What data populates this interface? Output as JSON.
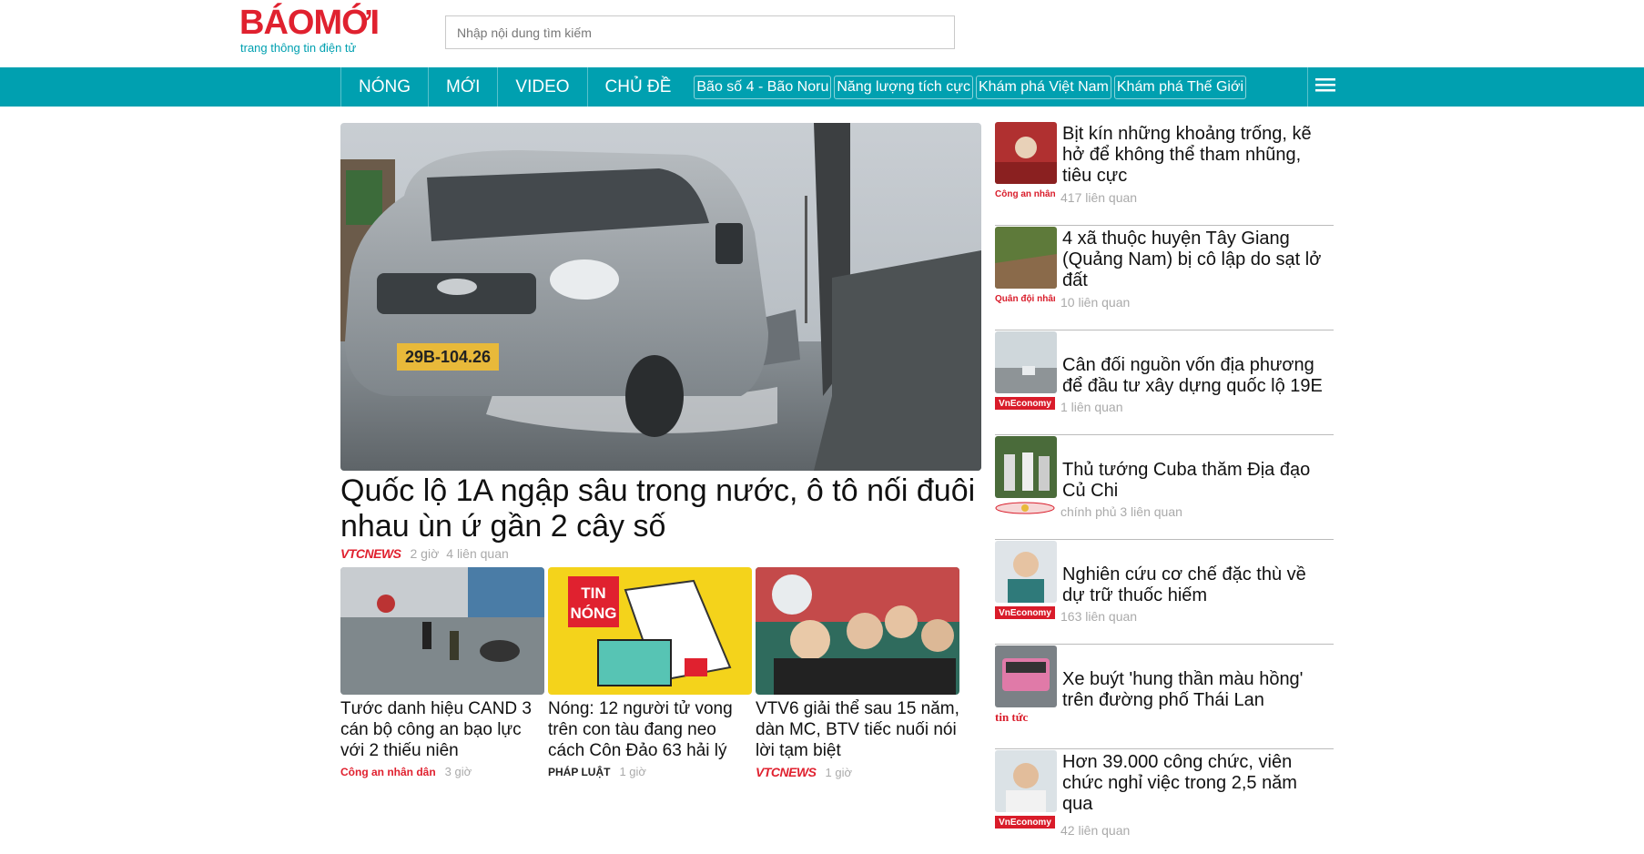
{
  "header": {
    "logo_text": "BÁOMỚI",
    "tagline": "trang thông tin điện tử",
    "search_placeholder": "Nhập nội dung tìm kiếm"
  },
  "nav": {
    "items": [
      "NÓNG",
      "MỚI",
      "VIDEO",
      "CHỦ ĐỀ"
    ],
    "topics": [
      "Bão số 4 - Bão Noru",
      "Năng lượng tích cực",
      "Khám phá Việt Nam",
      "Khám phá Thế Giới"
    ]
  },
  "hero": {
    "title": "Quốc lộ 1A ngập sâu trong nước, ô tô nối đuôi nhau ùn ứ gần 2 cây số",
    "source": "VTCNEWS",
    "time": "2 giờ",
    "related": "4 liên quan",
    "plate": "29B-104.26"
  },
  "cards": [
    {
      "title": "Tước danh hiệu CAND 3 cán bộ công an bạo lực với 2 thiếu niên",
      "source": "Công an nhân dân",
      "time": "3 giờ"
    },
    {
      "title": "Nóng: 12 người tử vong trên con tàu đang neo cách Côn Đảo 63 hải lý",
      "source": "PHÁP LUẬT",
      "time": "1 giờ",
      "thumb_badge": [
        "TIN",
        "NÓNG"
      ]
    },
    {
      "title": "VTV6 giải thể sau 15 năm, dàn MC, BTV tiếc nuối nói lời tạm biệt",
      "source": "VTCNEWS",
      "time": "1 giờ"
    }
  ],
  "sidebar": [
    {
      "title": "Bịt kín những khoảng trống, kẽ hở để không thể tham nhũng, tiêu cực",
      "source": "Công an nhân dân",
      "meta": "417 liên quan"
    },
    {
      "title": "4 xã thuộc huyện Tây Giang (Quảng Nam) bị cô lập do sạt lở đất",
      "source": "Quân đội nhân dân",
      "meta": "10 liên quan"
    },
    {
      "title": "Cân đối nguồn vốn địa phương để đầu tư xây dựng quốc lộ 19E",
      "source": "VnEconomy",
      "meta": "1 liên quan"
    },
    {
      "title": "Thủ tướng Cuba thăm Địa đạo Củ Chi",
      "source": "chính phủ",
      "meta": "chính phủ 3 liên quan"
    },
    {
      "title": "Nghiên cứu cơ chế đặc thù về dự trữ thuốc hiếm",
      "source": "VnEconomy",
      "meta": "163 liên quan"
    },
    {
      "title": "Xe buýt 'hung thần màu hồng' trên đường phố Thái Lan",
      "source": "tin tức",
      "meta": ""
    },
    {
      "title": "Hơn 39.000 công chức, viên chức nghỉ việc trong 2,5 năm qua",
      "source": "VnEconomy",
      "meta": "42 liên quan"
    }
  ],
  "colors": {
    "brand_red": "#e0212f",
    "brand_teal": "#00a0b0"
  }
}
